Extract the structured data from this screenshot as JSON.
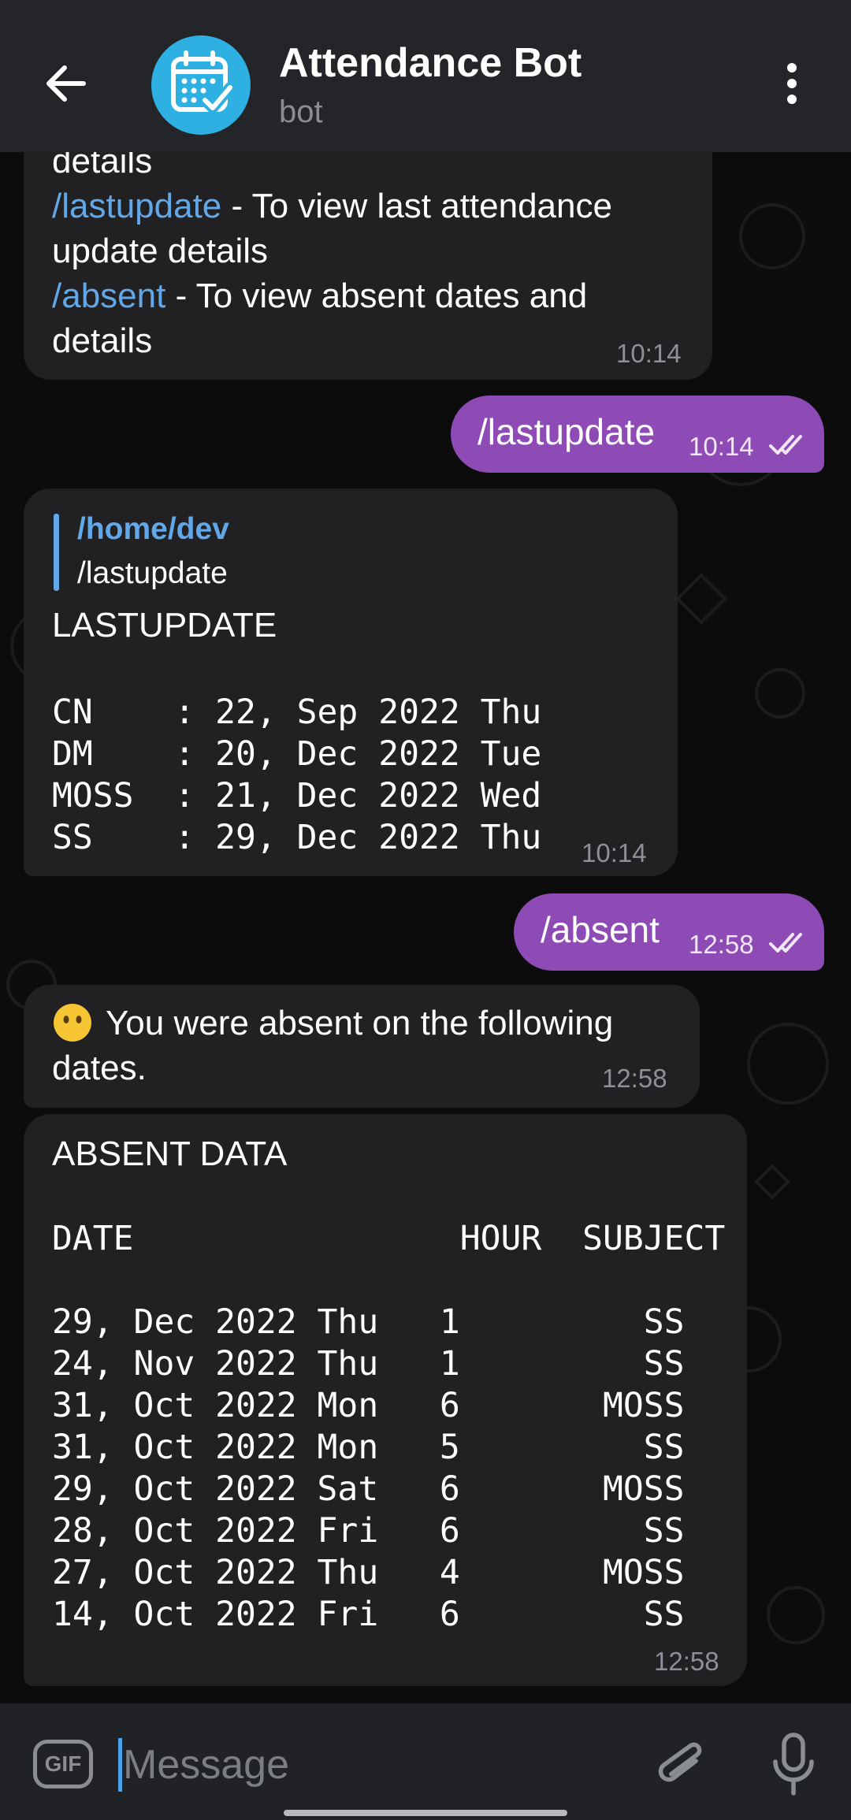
{
  "header": {
    "title": "Attendance Bot",
    "subtitle": "bot"
  },
  "messages": {
    "m1": {
      "line1": "details",
      "cmd1": "/lastupdate",
      "rest1": " - To view last attendance",
      "line3": "update details",
      "cmd2": "/absent",
      "rest2": " - To view absent dates and",
      "line5": "details",
      "time": "10:14"
    },
    "m2": {
      "text": "/lastupdate",
      "time": "10:14"
    },
    "m3": {
      "reply_name": "/home/dev",
      "reply_text": "/lastupdate",
      "heading": "LASTUPDATE",
      "rows": [
        "CN    : 22, Sep 2022 Thu",
        "DM    : 20, Dec 2022 Tue",
        "MOSS  : 21, Dec 2022 Wed",
        "SS    : 29, Dec 2022 Thu"
      ],
      "time": "10:14"
    },
    "m4": {
      "text": "/absent",
      "time": "12:58"
    },
    "m5": {
      "line1": "You were absent on the following",
      "line2": "dates.",
      "time": "12:58"
    },
    "m6": {
      "heading": "ABSENT DATA",
      "columns": "DATE                HOUR  SUBJECT",
      "rows": [
        "29, Dec 2022 Thu   1         SS",
        "24, Nov 2022 Thu   1         SS",
        "31, Oct 2022 Mon   6       MOSS",
        "31, Oct 2022 Mon   5         SS",
        "29, Oct 2022 Sat   6       MOSS",
        "28, Oct 2022 Fri   6         SS",
        "27, Oct 2022 Thu   4       MOSS",
        "14, Oct 2022 Fri   6         SS"
      ],
      "time": "12:58"
    }
  },
  "input": {
    "placeholder": "Message",
    "gif_label": "GIF"
  },
  "colors": {
    "header_bg": "#242528",
    "incoming_bubble": "#212124",
    "outgoing_bubble": "#8e4bb5",
    "link": "#62a8e8",
    "avatar": "#2fb0e3"
  },
  "icons": [
    "back-arrow-icon",
    "calendar-check-icon",
    "more-vert-icon",
    "double-check-icon",
    "neutral-face-emoji-icon",
    "gif-icon",
    "paperclip-icon",
    "microphone-icon"
  ]
}
